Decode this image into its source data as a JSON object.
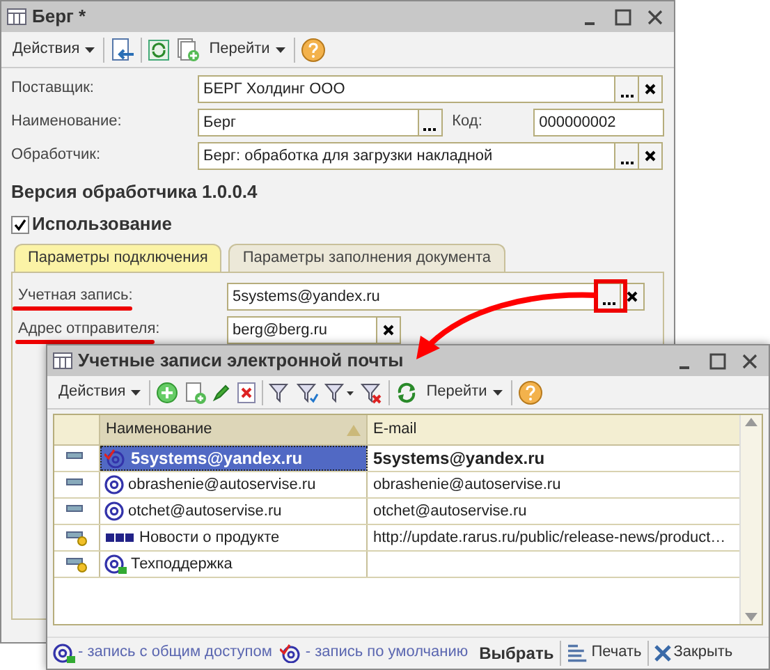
{
  "main_window": {
    "title": "Берг *",
    "menus": [
      "Действия",
      "Перейти"
    ],
    "fields": [
      {
        "label": "Поставщик:",
        "value": "БЕРГ Холдинг ООО",
        "kind": "ref"
      },
      {
        "label": "Наименование:",
        "value": "Берг",
        "kind": "named",
        "code_label": "Код:",
        "code": "000000002"
      },
      {
        "label": "Обработчик:",
        "value": "Берг: обработка для загрузки накладной",
        "kind": "ref"
      }
    ],
    "version": "Версия обработчика 1.0.0.4",
    "usage": {
      "label": "Использование",
      "checked": true
    },
    "tabs": [
      {
        "label": "Параметры подключения",
        "selected": true
      },
      {
        "label": "Параметры заполнения документа",
        "selected": false
      }
    ],
    "tab_fields": [
      {
        "label": "Учетная запись:",
        "value": "5systems@yandex.ru",
        "kind": "ref"
      },
      {
        "label": "Адрес отправителя:",
        "value": "berg@berg.ru",
        "kind": "clear"
      }
    ]
  },
  "dialog": {
    "title": "Учетные записи электронной почты",
    "menus": [
      "Действия",
      "Перейти"
    ],
    "columns": [
      "Наименование",
      "E-mail"
    ],
    "rows": [
      {
        "name": "5systems@yandex.ru",
        "email": "5systems@yandex.ru",
        "kind": "default",
        "shared": false,
        "selected": true
      },
      {
        "name": "obrashenie@autoservise.ru",
        "email": "obrashenie@autoservise.ru",
        "kind": "mail",
        "shared": false,
        "selected": false
      },
      {
        "name": "otchet@autoservise.ru",
        "email": "otchet@autoservise.ru",
        "kind": "mail",
        "shared": false,
        "selected": false
      },
      {
        "name": "Новости о продукте",
        "email": "http://update.rarus.ru/public/release-news/product…",
        "kind": "rss",
        "shared": true,
        "selected": false
      },
      {
        "name": "Техподдержка",
        "email": "",
        "kind": "shared",
        "shared": true,
        "selected": false
      }
    ],
    "legend": [
      {
        "kind": "shared",
        "text": "- запись с общим доступом"
      },
      {
        "kind": "default",
        "text": "- запись по умолчанию"
      }
    ],
    "buttons": [
      {
        "kind": "select",
        "label": "Выбрать"
      },
      {
        "kind": "print",
        "label": "Печать"
      },
      {
        "kind": "close",
        "label": "Закрыть"
      }
    ]
  }
}
